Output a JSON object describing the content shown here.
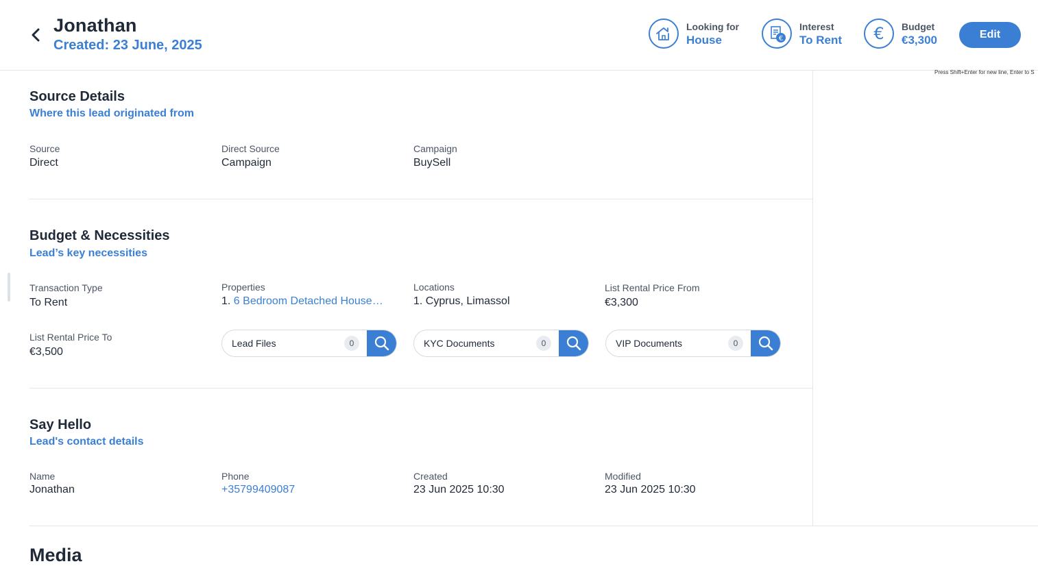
{
  "header": {
    "name": "Jonathan",
    "created": "Created: 23 June, 2025",
    "stats": [
      {
        "label": "Looking for",
        "value": "House",
        "icon": "house-icon"
      },
      {
        "label": "Interest",
        "value": "To Rent",
        "icon": "document-euro-icon"
      },
      {
        "label": "Budget",
        "value": "€3,300",
        "icon": "euro-icon"
      }
    ],
    "edit_label": "Edit",
    "hint": "Press Shift+Enter for new line, Enter to S"
  },
  "source": {
    "title": "Source Details",
    "subtitle": "Where this lead originated from",
    "fields": [
      {
        "label": "Source",
        "value": "Direct"
      },
      {
        "label": "Direct Source",
        "value": "Campaign"
      },
      {
        "label": "Campaign",
        "value": "BuySell"
      }
    ]
  },
  "budget": {
    "title": "Budget & Necessities",
    "subtitle": "Lead’s key necessities",
    "transaction": {
      "label": "Transaction Type",
      "value": "To Rent"
    },
    "properties": {
      "label": "Properties",
      "index": "1.",
      "value": "6 Bedroom Detached House…"
    },
    "locations": {
      "label": "Locations",
      "value": "1. Cyprus, Limassol"
    },
    "price_from": {
      "label": "List Rental Price From",
      "value": "€3,300"
    },
    "price_to": {
      "label": "List Rental Price To",
      "value": "€3,500"
    },
    "docs": [
      {
        "name": "Lead Files",
        "count": "0"
      },
      {
        "name": "KYC Documents",
        "count": "0"
      },
      {
        "name": "VIP Documents",
        "count": "0"
      }
    ]
  },
  "hello": {
    "title": "Say Hello",
    "subtitle": "Lead's contact details",
    "fields": [
      {
        "label": "Name",
        "value": "Jonathan"
      },
      {
        "label": "Phone",
        "value": "+35799409087"
      },
      {
        "label": "Created",
        "value": "23 Jun 2025 10:30"
      },
      {
        "label": "Modified",
        "value": "23 Jun 2025 10:30"
      }
    ]
  },
  "media": {
    "title": "Media"
  },
  "colors": {
    "accent": "#3b7fd4",
    "text": "#1f2937",
    "muted": "#4b5563",
    "divider": "#e3e5e8"
  }
}
